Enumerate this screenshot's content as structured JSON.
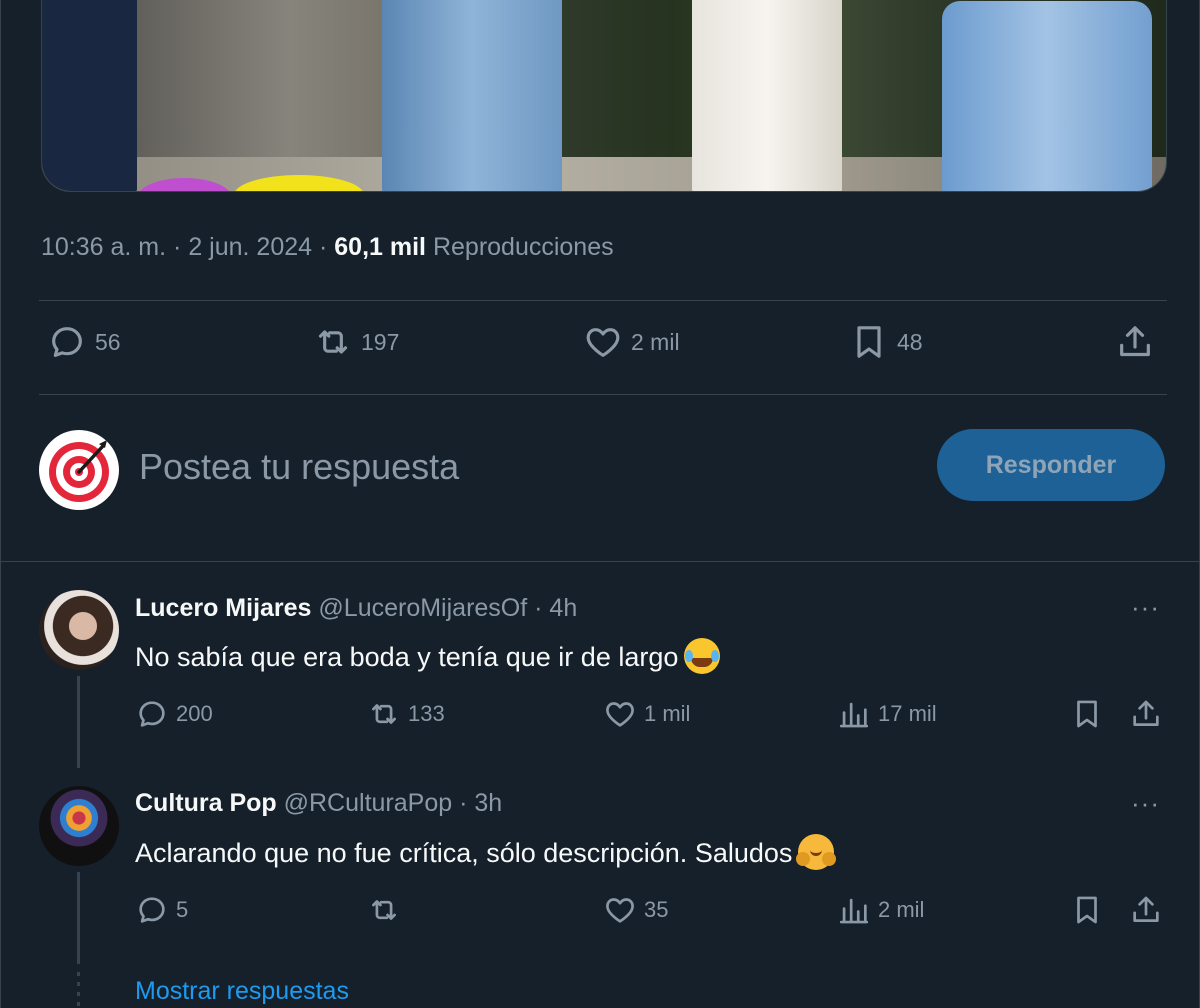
{
  "tweet": {
    "time": "10:36 a. m.",
    "date": "2 jun. 2024",
    "views_count": "60,1 mil",
    "views_label": "Reproducciones",
    "replies": "56",
    "retweets": "197",
    "likes": "2 mil",
    "bookmarks": "48"
  },
  "compose": {
    "placeholder": "Postea tu respuesta",
    "button_label": "Responder"
  },
  "replies": [
    {
      "name": "Lucero Mijares",
      "handle": "@LuceroMijaresOf",
      "time": "4h",
      "text": "No sabía que era boda y tenía que ir de largo",
      "emoji": "face-with-tears-of-joy",
      "replies": "200",
      "retweets": "133",
      "likes": "1 mil",
      "views": "17 mil"
    },
    {
      "name": "Cultura Pop",
      "handle": "@RCulturaPop",
      "time": "3h",
      "text": "Aclarando que no fue crítica,  sólo descripción. Saludos",
      "emoji": "hugging-face",
      "replies": "5",
      "retweets": "",
      "likes": "35",
      "views": "2 mil"
    }
  ],
  "separator": "·",
  "more_glyph": "···",
  "show_replies": "Mostrar respuestas",
  "colors": {
    "background": "#15202b",
    "border": "#38444d",
    "muted_text": "#8b98a5",
    "accent": "#1d9bf0",
    "reply_button": "#1d6197"
  }
}
